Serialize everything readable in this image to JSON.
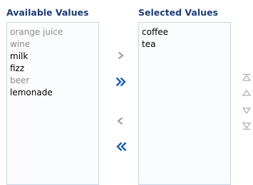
{
  "available": {
    "header": "Available Values",
    "items": [
      {
        "label": "orange juice",
        "enabled": false
      },
      {
        "label": "wine",
        "enabled": false
      },
      {
        "label": "milk",
        "enabled": true
      },
      {
        "label": "fizz",
        "enabled": true
      },
      {
        "label": "beer",
        "enabled": false
      },
      {
        "label": "lemonade",
        "enabled": true
      }
    ]
  },
  "selected": {
    "header": "Selected Values",
    "items": [
      {
        "label": "coffee"
      },
      {
        "label": "tea"
      }
    ]
  },
  "shuttle_buttons": [
    "move-icon",
    "move-all-icon",
    "remove-icon",
    "remove-all-icon"
  ],
  "reorder_buttons": [
    "move-top-icon",
    "move-up-icon",
    "move-down-icon",
    "move-bottom-icon"
  ],
  "colors": {
    "header": "#1f3d73",
    "border": "#c9d6e3",
    "disabled_text": "#8a8a8a",
    "active_arrow": "#1a5fb4",
    "inactive_arrow": "#8c8c8c"
  }
}
